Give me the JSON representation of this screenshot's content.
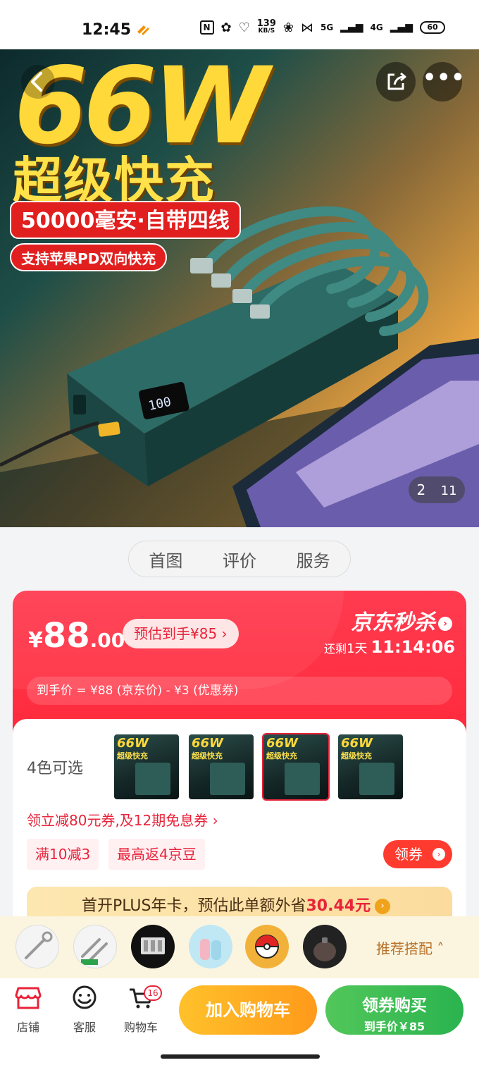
{
  "status_bar": {
    "time": "12:45",
    "speed_value": "139",
    "speed_unit": "KB/S",
    "net1": "5G",
    "net2": "4G",
    "battery": "60"
  },
  "hero": {
    "headline": "66W",
    "subheadline": "超级快充",
    "tag_capacity": "50000毫安·自带四线",
    "tag_pd": "支持苹果PD双向快充",
    "counter_current": "2",
    "counter_total": "11"
  },
  "tabs": [
    {
      "label": "首图"
    },
    {
      "label": "评价"
    },
    {
      "label": "服务"
    }
  ],
  "price": {
    "currency": "¥",
    "integer": "88",
    "decimal": ".00",
    "estimate": "预估到手¥85 ›",
    "flash_sale": "京东秒杀",
    "countdown_prefix": "还剩",
    "countdown_days": "1天",
    "countdown_time": "11:14:06",
    "formula": "到手价 = ¥88 (京东价) - ¥3 (优惠券)"
  },
  "variants": {
    "label": "4色可选",
    "thumb_title": "66W",
    "thumb_sub": "超级快充"
  },
  "coupons": {
    "headline": "领立减80元券,及12期免息券 ›",
    "chip1": "满10减3",
    "chip2": "最高返4京豆",
    "button": "领券"
  },
  "plus": {
    "text": "首开PLUS年卡，预估此单额外省",
    "amount": "30.44元"
  },
  "recommend": {
    "label": "推荐搭配 ˄"
  },
  "bottom_bar": {
    "store": "店铺",
    "service": "客服",
    "cart": "购物车",
    "cart_badge": "16",
    "add_to_cart": "加入购物车",
    "buy_line1": "领券购买",
    "buy_line2": "到手价￥85"
  },
  "colors": {
    "accent_red": "#ff2b3d",
    "buy_green": "#2ab34f",
    "cart_orange": "#ff9a1a"
  }
}
